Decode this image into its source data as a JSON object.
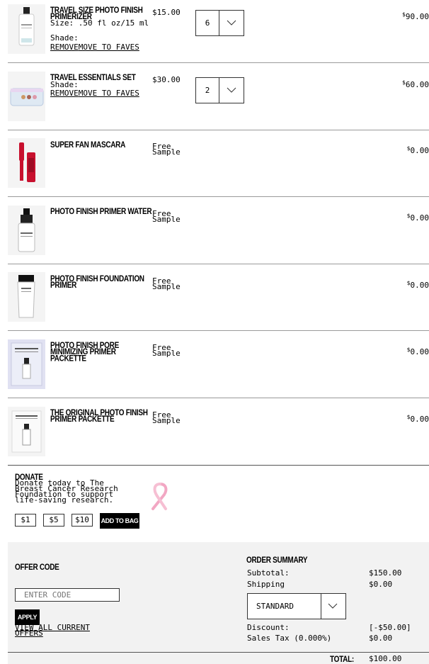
{
  "currency_symbol": "$",
  "labels": {
    "size": "Size:",
    "shade": "Shade:",
    "remove": "REMOVE",
    "move_to_faves": "MOVE TO FAVES"
  },
  "items": [
    {
      "name": "TRAVEL SIZE PHOTO FINISH PRIMERIZER",
      "size": ".50 fl oz/15 ml",
      "price": "$15.00",
      "qty": "6",
      "total": "90.00"
    },
    {
      "name": "TRAVEL ESSENTIALS SET",
      "price": "$30.00",
      "qty": "2",
      "total": "60.00"
    },
    {
      "name": "SUPER FAN MASCARA",
      "price": "Free Sample",
      "total": "0.00"
    },
    {
      "name": "PHOTO FINISH PRIMER WATER",
      "price": "Free Sample",
      "total": "0.00"
    },
    {
      "name": "PHOTO FINISH FOUNDATION PRIMER",
      "price": "Free Sample",
      "total": "0.00"
    },
    {
      "name": "PHOTO FINISH PORE MINIMIZING PRIMER PACKETTE",
      "price": "Free Sample",
      "total": "0.00"
    },
    {
      "name": "THE ORIGINAL PHOTO FINISH PRIMER PACKETTE",
      "price": "Free Sample",
      "total": "0.00"
    }
  ],
  "donate": {
    "title": "DONATE",
    "text": "Donate today to The Breast Cancer Research Foundation to support life-saving research.",
    "amounts": [
      "$1",
      "$5",
      "$10"
    ],
    "add_to_bag": "ADD TO BAG",
    "ribbon_color": "#f2a7c3"
  },
  "offer": {
    "title": "OFFER CODE",
    "placeholder": "ENTER CODE",
    "apply": "APPLY",
    "view_all": "VIEW ALL CURRENT OFFERS"
  },
  "summary": {
    "title": "ORDER SUMMARY",
    "subtotal_label": "Subtotal:",
    "subtotal": "$150.00",
    "shipping_label": "Shipping",
    "shipping": "$0.00",
    "shipping_method": "STANDARD",
    "discount_label": "Discount:",
    "discount": "[-$50.00]",
    "tax_label": "Sales Tax (0.000%)",
    "tax": "$0.00",
    "total_label": "TOTAL:",
    "total": "$100.00"
  }
}
